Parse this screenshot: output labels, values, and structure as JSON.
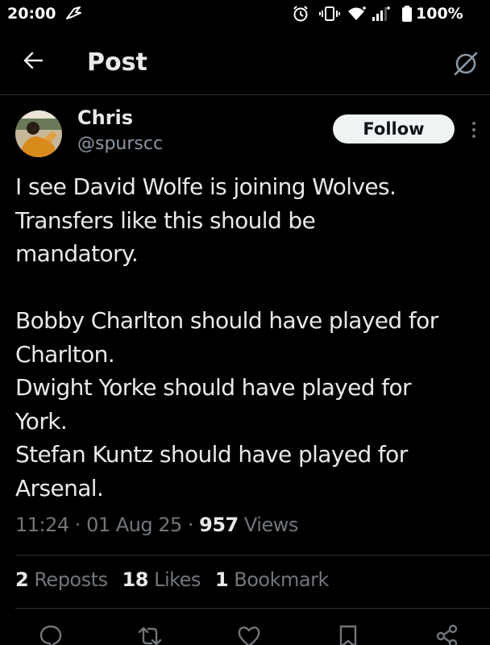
{
  "status_bar": {
    "time": "20:00",
    "battery": "100%",
    "icons": [
      "notification-icon",
      "alarm-icon",
      "vibrate-icon",
      "wifi-icon",
      "signal-icon",
      "battery-icon"
    ]
  },
  "header": {
    "title": "Post",
    "icons": [
      "back-arrow-icon",
      "grok-icon"
    ]
  },
  "author": {
    "name": "Chris",
    "handle": "@spurscc",
    "follow_label": "Follow"
  },
  "tweet": {
    "lines": [
      "I see David Wolfe is joining Wolves.",
      "Transfers like this should be",
      "mandatory.",
      "",
      "Bobby Charlton should have played for",
      "Charlton.",
      "Dwight Yorke should have played for",
      "York.",
      "Stefan Kuntz should have played for",
      "Arsenal."
    ]
  },
  "meta": {
    "time": "11:24",
    "sep1": " · ",
    "date": "01 Aug 25",
    "sep2": " · ",
    "views_count": "957",
    "views_label": " Views"
  },
  "stats": {
    "reposts_count": "2",
    "reposts_label": " Reposts",
    "likes_count": "18",
    "likes_label": " Likes",
    "bookmarks_count": "1",
    "bookmarks_label": " Bookmark"
  },
  "actions": [
    "reply-icon",
    "repost-icon",
    "like-icon",
    "bookmark-icon",
    "share-icon"
  ],
  "colors": {
    "background": "#000000",
    "text": "#e7e9ea",
    "muted": "#71767b",
    "handle": "#8b98a5",
    "divider": "#2f3336",
    "follow_bg": "#eff3f4"
  }
}
